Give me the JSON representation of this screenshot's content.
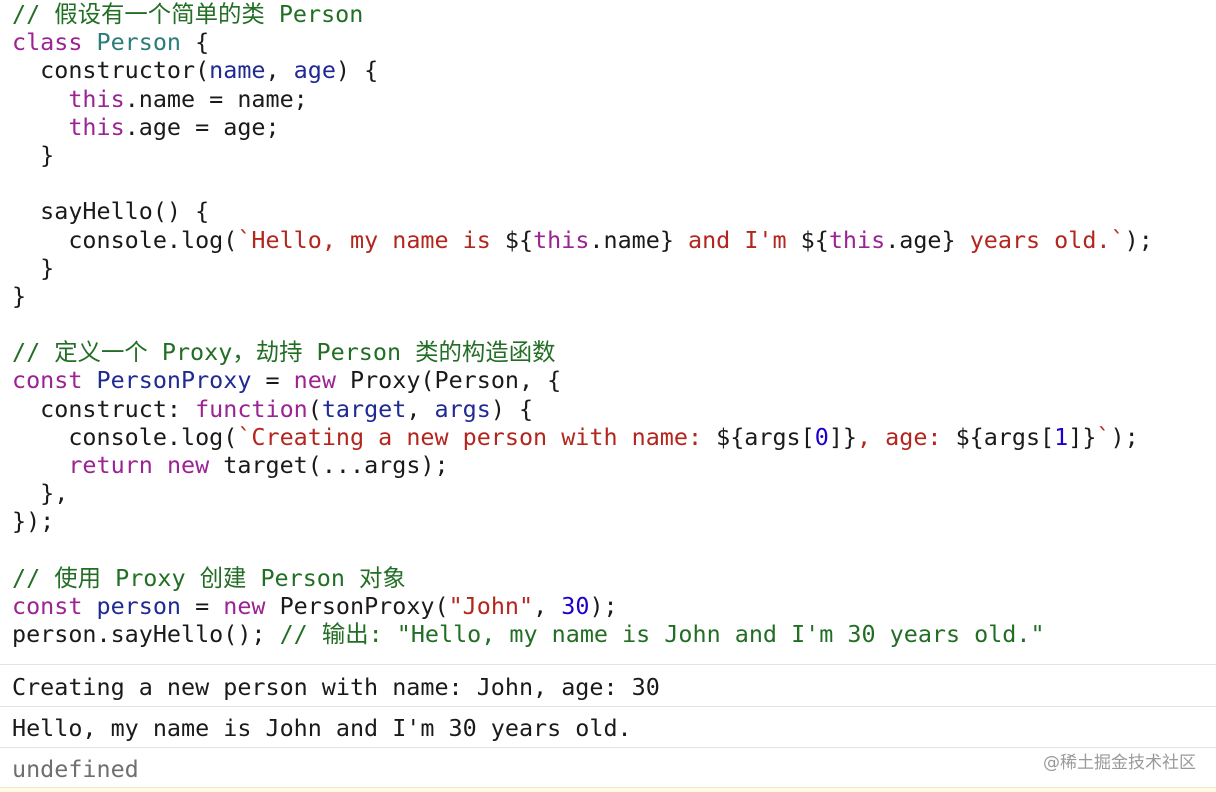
{
  "code_lines": [
    [
      {
        "t": "c",
        "v": "// 假设有一个简单的类 Person"
      }
    ],
    [
      {
        "t": "k",
        "v": "class"
      },
      {
        "t": "p",
        "v": " "
      },
      {
        "t": "cls",
        "v": "Person"
      },
      {
        "t": "p",
        "v": " {"
      }
    ],
    [
      {
        "t": "p",
        "v": "  constructor("
      },
      {
        "t": "par",
        "v": "name"
      },
      {
        "t": "p",
        "v": ", "
      },
      {
        "t": "par",
        "v": "age"
      },
      {
        "t": "p",
        "v": ") {"
      }
    ],
    [
      {
        "t": "p",
        "v": "    "
      },
      {
        "t": "k",
        "v": "this"
      },
      {
        "t": "p",
        "v": ".name = name;"
      }
    ],
    [
      {
        "t": "p",
        "v": "    "
      },
      {
        "t": "k",
        "v": "this"
      },
      {
        "t": "p",
        "v": ".age = age;"
      }
    ],
    [
      {
        "t": "p",
        "v": "  }"
      }
    ],
    [
      {
        "t": "p",
        "v": ""
      }
    ],
    [
      {
        "t": "p",
        "v": "  sayHello() {"
      }
    ],
    [
      {
        "t": "p",
        "v": "    console.log("
      },
      {
        "t": "s",
        "v": "`Hello, my name is "
      },
      {
        "t": "p",
        "v": "${"
      },
      {
        "t": "k",
        "v": "this"
      },
      {
        "t": "p",
        "v": ".name}"
      },
      {
        "t": "s",
        "v": " and I'm "
      },
      {
        "t": "p",
        "v": "${"
      },
      {
        "t": "k",
        "v": "this"
      },
      {
        "t": "p",
        "v": ".age}"
      },
      {
        "t": "s",
        "v": " years old.`"
      },
      {
        "t": "p",
        "v": ");"
      }
    ],
    [
      {
        "t": "p",
        "v": "  }"
      }
    ],
    [
      {
        "t": "p",
        "v": "}"
      }
    ],
    [
      {
        "t": "p",
        "v": ""
      }
    ],
    [
      {
        "t": "c",
        "v": "// 定义一个 Proxy，劫持 Person 类的构造函数"
      }
    ],
    [
      {
        "t": "k",
        "v": "const"
      },
      {
        "t": "p",
        "v": " "
      },
      {
        "t": "par",
        "v": "PersonProxy"
      },
      {
        "t": "p",
        "v": " = "
      },
      {
        "t": "k",
        "v": "new"
      },
      {
        "t": "p",
        "v": " Proxy(Person, {"
      }
    ],
    [
      {
        "t": "p",
        "v": "  construct: "
      },
      {
        "t": "k",
        "v": "function"
      },
      {
        "t": "p",
        "v": "("
      },
      {
        "t": "par",
        "v": "target"
      },
      {
        "t": "p",
        "v": ", "
      },
      {
        "t": "par",
        "v": "args"
      },
      {
        "t": "p",
        "v": ") {"
      }
    ],
    [
      {
        "t": "p",
        "v": "    console.log("
      },
      {
        "t": "s",
        "v": "`Creating a new person with name: "
      },
      {
        "t": "p",
        "v": "${args["
      },
      {
        "t": "n",
        "v": "0"
      },
      {
        "t": "p",
        "v": "]}"
      },
      {
        "t": "s",
        "v": ", age: "
      },
      {
        "t": "p",
        "v": "${args["
      },
      {
        "t": "n",
        "v": "1"
      },
      {
        "t": "p",
        "v": "]}"
      },
      {
        "t": "s",
        "v": "`"
      },
      {
        "t": "p",
        "v": ");"
      }
    ],
    [
      {
        "t": "p",
        "v": "    "
      },
      {
        "t": "k",
        "v": "return"
      },
      {
        "t": "p",
        "v": " "
      },
      {
        "t": "k",
        "v": "new"
      },
      {
        "t": "p",
        "v": " target(...args);"
      }
    ],
    [
      {
        "t": "p",
        "v": "  },"
      }
    ],
    [
      {
        "t": "p",
        "v": "});"
      }
    ],
    [
      {
        "t": "p",
        "v": ""
      }
    ],
    [
      {
        "t": "c",
        "v": "// 使用 Proxy 创建 Person 对象"
      }
    ],
    [
      {
        "t": "k",
        "v": "const"
      },
      {
        "t": "p",
        "v": " "
      },
      {
        "t": "par",
        "v": "person"
      },
      {
        "t": "p",
        "v": " = "
      },
      {
        "t": "k",
        "v": "new"
      },
      {
        "t": "p",
        "v": " PersonProxy("
      },
      {
        "t": "s",
        "v": "\"John\""
      },
      {
        "t": "p",
        "v": ", "
      },
      {
        "t": "n",
        "v": "30"
      },
      {
        "t": "p",
        "v": ");"
      }
    ],
    [
      {
        "t": "p",
        "v": "person.sayHello(); "
      },
      {
        "t": "c",
        "v": "// 输出: \"Hello, my name is John and I'm 30 years old.\""
      }
    ]
  ],
  "console": {
    "lines": [
      "Creating a new person with name: John, age: 30",
      "Hello, my name is John and I'm 30 years old.",
      "undefined"
    ]
  },
  "watermark": "@稀土掘金技术社区",
  "colors": {
    "comment": "#236e25",
    "keyword": "#9b2393",
    "class_name": "#2a7d78",
    "parameter": "#1f2a92",
    "string": "#b3261e",
    "number": "#1c00cf",
    "plain": "#1a1a1a"
  }
}
